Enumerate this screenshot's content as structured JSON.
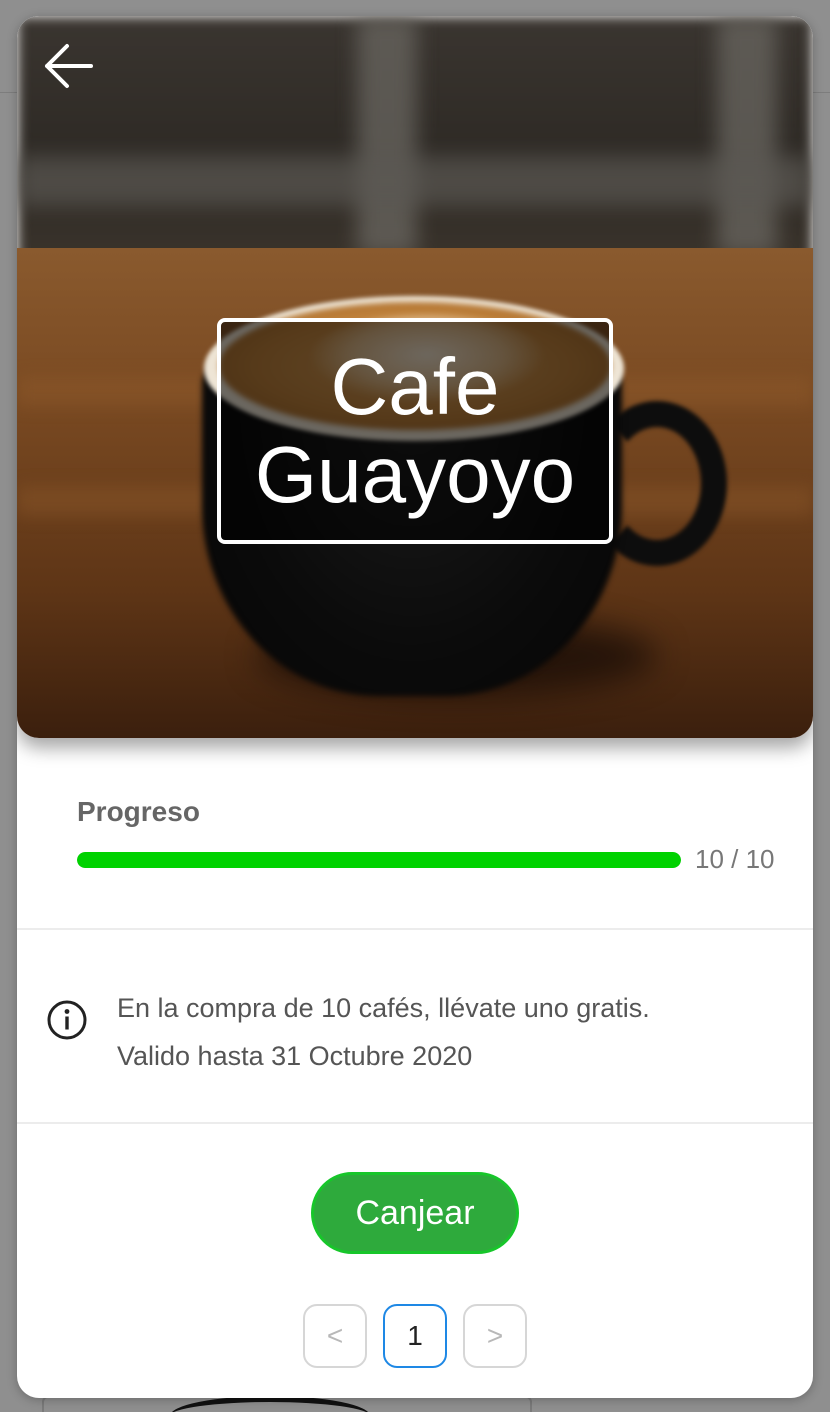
{
  "header": {
    "title_line1": "Cafe",
    "title_line2": "Guayoyo",
    "back_icon": "arrow-left-icon"
  },
  "progress": {
    "label": "Progreso",
    "current": 10,
    "total": 10,
    "count_text": "10 / 10",
    "fill_fraction": 1.0,
    "bar_color": "#00d200"
  },
  "info": {
    "icon": "info-circle-icon",
    "line1": "En la compra de 10 cafés, llévate uno gratis.",
    "line2": "Valido hasta 31 Octubre 2020"
  },
  "actions": {
    "redeem_label": "Canjear",
    "redeem_color": "#2eaa3c"
  },
  "pagination": {
    "prev_symbol": "<",
    "current_page": "1",
    "next_symbol": ">"
  }
}
